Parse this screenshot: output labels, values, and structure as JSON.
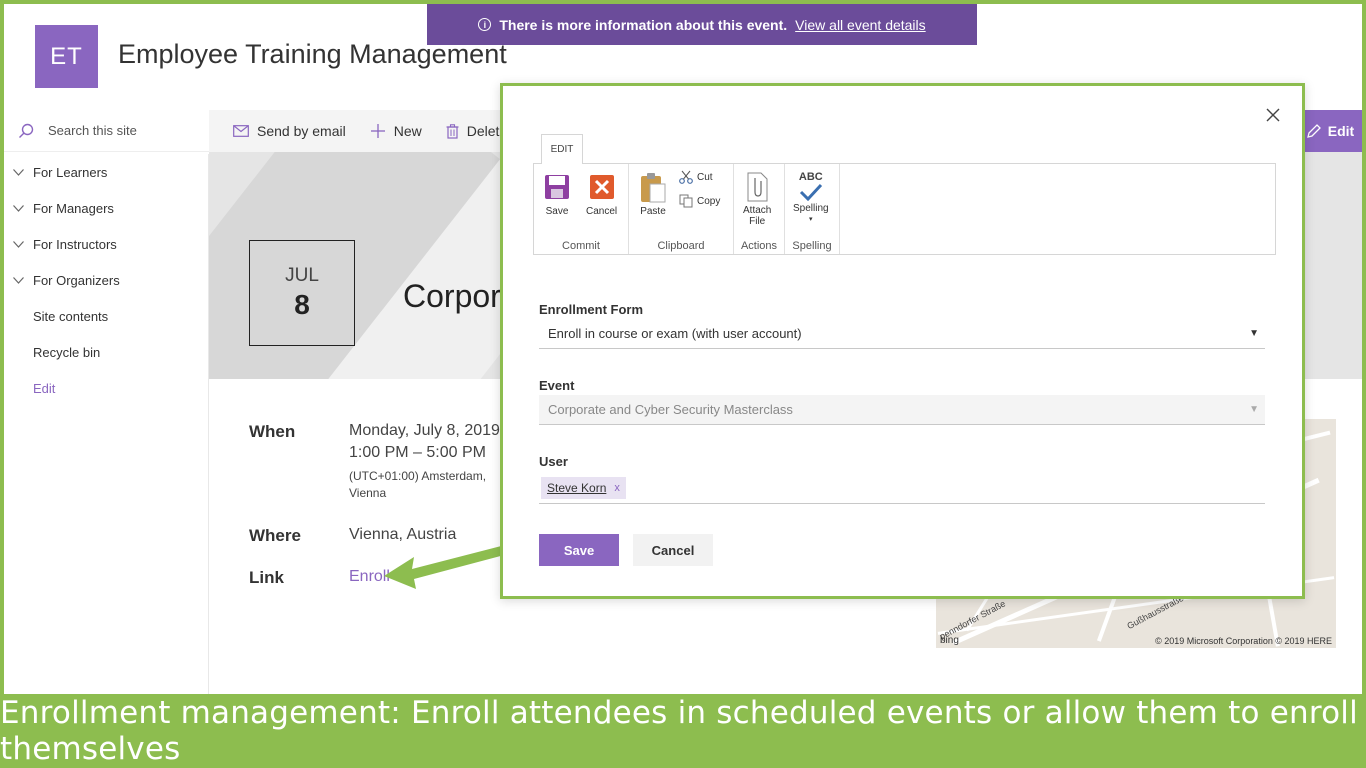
{
  "banner": {
    "text": "There is more information about this event.",
    "link": "View all event details"
  },
  "site": {
    "logo": "ET",
    "title": "Employee Training Management"
  },
  "search": {
    "placeholder": "Search this site"
  },
  "commands": {
    "send_email": "Send by email",
    "new": "New",
    "delete": "Delete",
    "edit": "Edit"
  },
  "nav": [
    {
      "label": "For Learners",
      "expandable": true
    },
    {
      "label": "For Managers",
      "expandable": true
    },
    {
      "label": "For Instructors",
      "expandable": true
    },
    {
      "label": "For Organizers",
      "expandable": true
    },
    {
      "label": "Site contents",
      "expandable": false
    },
    {
      "label": "Recycle bin",
      "expandable": false
    },
    {
      "label": "Edit",
      "expandable": false
    }
  ],
  "event": {
    "month": "JUL",
    "day": "8",
    "title_visible": "Corpor",
    "when_label": "When",
    "when_date": "Monday, July 8, 2019",
    "when_time": "1:00 PM – 5:00 PM",
    "when_tz1": "(UTC+01:00) Amsterdam,",
    "when_tz2": "Vienna",
    "where_label": "Where",
    "where_value": "Vienna, Austria",
    "link_label": "Link",
    "link_value": "Enroll"
  },
  "map": {
    "credit": "© 2019 Microsoft Corporation © 2019 HERE",
    "bing": "bing",
    "street1": "Gußhausstraße",
    "street2": "penndorfer Straße"
  },
  "modal": {
    "ribbon_tab": "EDIT",
    "groups": {
      "commit": "Commit",
      "clipboard": "Clipboard",
      "actions": "Actions",
      "spelling": "Spelling"
    },
    "buttons": {
      "save": "Save",
      "cancel": "Cancel",
      "paste": "Paste",
      "cut": "Cut",
      "copy": "Copy",
      "attach1": "Attach",
      "attach2": "File",
      "spelling": "Spelling",
      "abc": "ABC"
    },
    "form": {
      "enrollment_label": "Enrollment Form",
      "enrollment_value": "Enroll in course or exam (with user account)",
      "event_label": "Event",
      "event_value": "Corporate and Cyber Security Masterclass",
      "user_label": "User",
      "user_value": "Steve Korn",
      "user_remove": "x"
    },
    "save_label": "Save",
    "cancel_label": "Cancel"
  },
  "caption": "Enrollment management: Enroll attendees in scheduled events or allow them to enroll themselves",
  "colors": {
    "accent": "#8a66c0",
    "banner": "#6b4c9a",
    "frame_green": "#8dbd4f"
  }
}
